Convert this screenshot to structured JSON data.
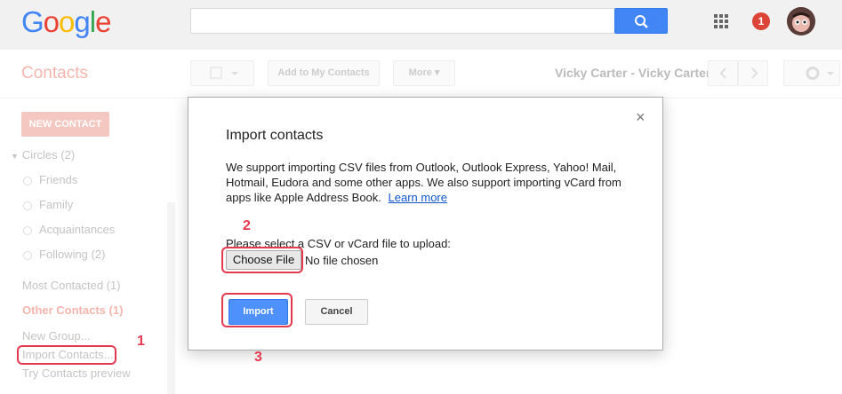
{
  "logo": {
    "g1": "G",
    "o1": "o",
    "o2": "o",
    "g2": "g",
    "l": "l",
    "e": "e"
  },
  "header": {
    "notification_count": "1"
  },
  "page": {
    "title": "Contacts"
  },
  "toolbar": {
    "add_to_my_contacts": "Add to My Contacts",
    "more": "More ▾",
    "contact_name": "Vicky Carter - Vicky Carter"
  },
  "sidebar": {
    "new_contact": "NEW CONTACT",
    "circles": "Circles (2)",
    "circle_items": [
      "Friends",
      "Family",
      "Acquaintances",
      "Following (2)"
    ],
    "most_contacted": "Most Contacted (1)",
    "other_contacts": "Other Contacts (1)",
    "new_group": "New Group...",
    "import_contacts": "Import Contacts...",
    "try_preview": "Try Contacts preview"
  },
  "dialog": {
    "close": "×",
    "title": "Import contacts",
    "description": "We support importing CSV files from Outlook, Outlook Express, Yahoo! Mail, Hotmail, Eudora and some other apps. We also support importing vCard from apps like Apple Address Book.",
    "learn_more": "Learn more",
    "select_label": "Please select a CSV or vCard file to upload:",
    "choose_file": "Choose File",
    "no_file": "No file chosen",
    "import": "Import",
    "cancel": "Cancel"
  },
  "annotations": {
    "step1": "1",
    "step2": "2",
    "step3": "3"
  },
  "colors": {
    "accent_red": "#e53950",
    "import_blue": "#4d90fe",
    "brand_blue": "#4285f4"
  }
}
